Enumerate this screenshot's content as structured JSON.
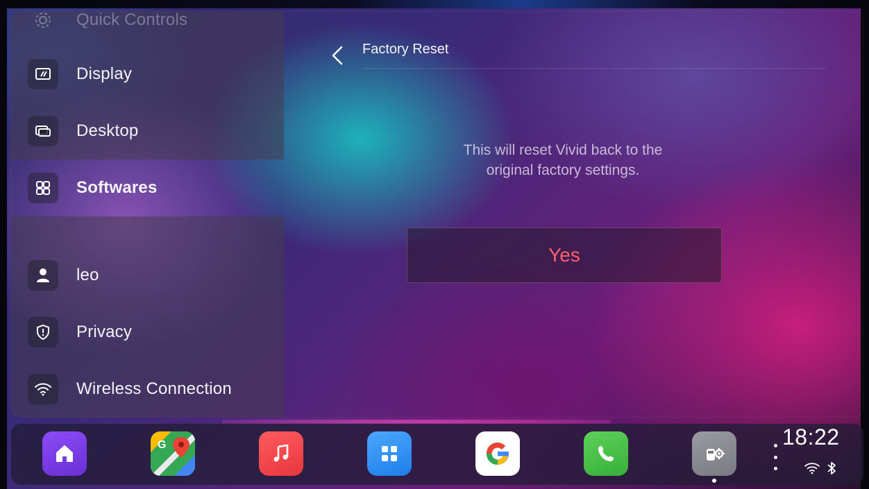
{
  "sidebar": {
    "items": [
      {
        "label": "Quick Controls",
        "icon": "gear-icon"
      },
      {
        "label": "Display",
        "icon": "display-icon"
      },
      {
        "label": "Desktop",
        "icon": "desktop-icon"
      },
      {
        "label": "Softwares",
        "icon": "apps-grid-icon"
      },
      {
        "label": "leo",
        "icon": "user-icon"
      },
      {
        "label": "Privacy",
        "icon": "shield-icon"
      },
      {
        "label": "Wireless Connection",
        "icon": "wifi-icon"
      }
    ],
    "active": "Softwares"
  },
  "content": {
    "title": "Factory Reset",
    "description_line1": "This will reset Vivid back to the",
    "description_line2": "original factory settings.",
    "confirm_button": "Yes"
  },
  "dock": {
    "apps": [
      {
        "name": "home-app-icon",
        "color": "#7b3fe4"
      },
      {
        "name": "google-maps-app-icon"
      },
      {
        "name": "music-app-icon",
        "color": "#f04a50"
      },
      {
        "name": "app-grid-app-icon",
        "color": "#2d8cf0"
      },
      {
        "name": "google-app-icon"
      },
      {
        "name": "phone-app-icon",
        "color": "#4cc24a"
      },
      {
        "name": "car-settings-app-icon",
        "color": "#8e8e96"
      }
    ],
    "time": "18:22"
  },
  "colors": {
    "accent_red": "#ff5e6e"
  }
}
